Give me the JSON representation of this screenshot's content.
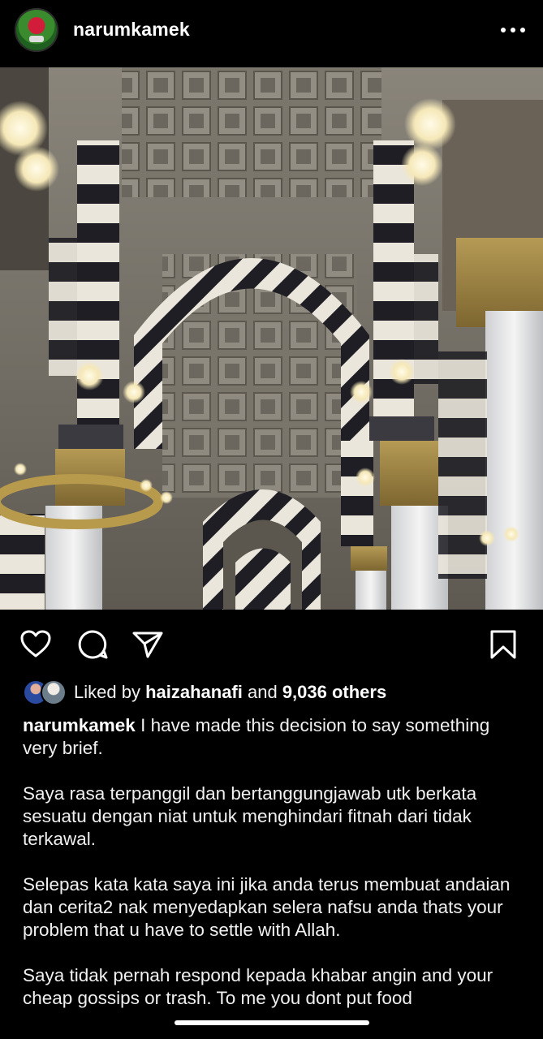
{
  "header": {
    "username": "narumkamek",
    "avatar_icon": "profile-avatar",
    "more_icon": "more-options-icon"
  },
  "post": {
    "image_icon": "mosque-interior-photo"
  },
  "actions": {
    "like_icon": "heart-icon",
    "comment_icon": "comment-icon",
    "share_icon": "paper-plane-icon",
    "save_icon": "bookmark-icon"
  },
  "likes": {
    "prefix": "Liked by ",
    "user": "haizahanafi",
    "middle": " and ",
    "others": "9,036 others"
  },
  "caption": {
    "username": "narumkamek",
    "lead": " I have made this decision to say something very brief.",
    "paragraphs": [
      "Saya rasa terpanggil dan bertanggungjawab utk berkata sesuatu dengan niat untuk menghindari fitnah dari tidak terkawal.",
      "Selepas kata kata saya ini jika anda terus membuat andaian dan cerita2 nak menyedapkan selera nafsu anda thats your problem that u have to settle with Allah.",
      "Saya tidak pernah respond kepada khabar angin and your cheap gossips or trash. To me you dont put food"
    ]
  },
  "colors": {
    "background": "#000000",
    "text": "#f5f5f5"
  }
}
